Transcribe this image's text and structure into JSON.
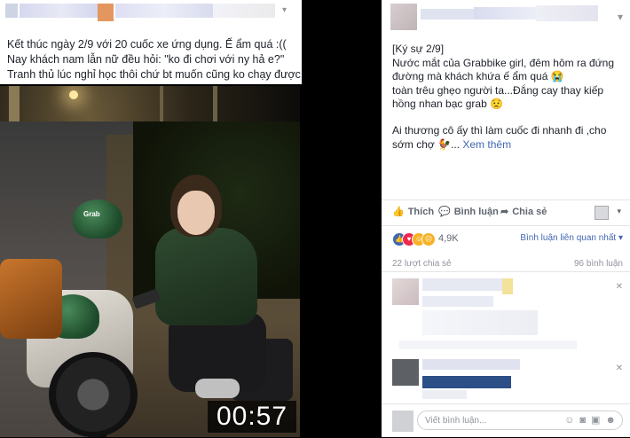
{
  "left_post": {
    "lines": [
      "Kết thúc ngày 2/9 với 20 cuốc xe ứng dụng. Ế ẩm quá :((",
      "Nay khách nam lẫn nữ đều hỏi: \"ko đi chơi với ny hả e?\"",
      "Tranh thủ lúc nghỉ học thôi chứ bt muốn cũng ko chạy được!"
    ],
    "helmet_brand": "Grab",
    "video_timer": "00:57"
  },
  "right_post": {
    "paragraphs": [
      "[Ký sự 2/9]",
      "Nước mắt của Grabbike girl, đêm hôm ra đứng đường mà khách khứa ế ẩm quá 😭",
      "toàn trêu ghẹo người ta...Đắng cay thay kiếp hồng nhan bạc grab 😟",
      "Ai thương cô ấy thì làm cuốc đi nhanh đi ,cho sớm chợ 🐓...",
      "Xem thêm"
    ],
    "actions": {
      "like": "Thích",
      "comment": "Bình luận",
      "share": "Chia sẻ"
    },
    "reactions_count": "4,9K",
    "sort_label": "Bình luận liên quan nhất",
    "shares": "22 lượt chia sẻ",
    "comments": "96 bình luận",
    "comment_placeholder": "Viết bình luận..."
  },
  "colors": {
    "link": "#4267b2",
    "text": "#1d2129",
    "muted": "#90949c",
    "grab_green": "#1d4a2a",
    "like_blue": "#4267b2",
    "love_red": "#f0284a",
    "haha_yellow": "#f7b125"
  }
}
